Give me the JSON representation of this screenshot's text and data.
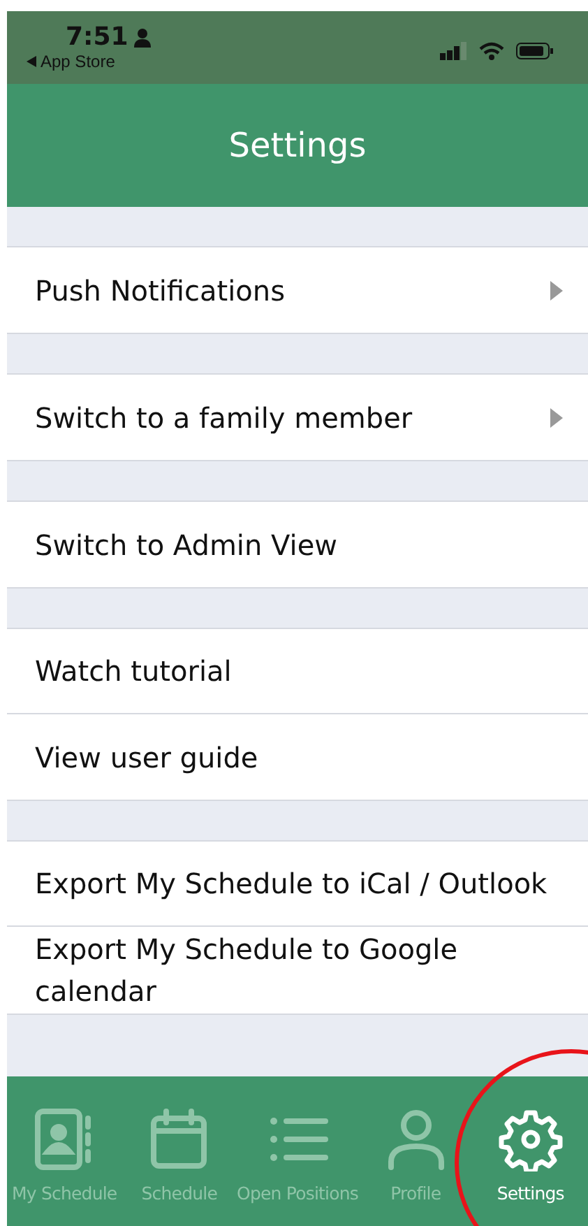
{
  "status_bar": {
    "time": "7:51",
    "back_label": "App Store"
  },
  "header": {
    "title": "Settings"
  },
  "sections": [
    {
      "items": [
        {
          "label": "Push Notifications",
          "kind": "submenu"
        }
      ]
    },
    {
      "items": [
        {
          "label": "Switch to a family member",
          "kind": "submenu"
        }
      ]
    },
    {
      "items": [
        {
          "label": "Switch to Admin View",
          "kind": "action"
        }
      ]
    },
    {
      "items": [
        {
          "label": "Watch tutorial",
          "kind": "action"
        },
        {
          "label": "View user guide",
          "kind": "action"
        }
      ]
    },
    {
      "items": [
        {
          "label": "Export My Schedule to iCal / Outlook",
          "kind": "action"
        },
        {
          "label": "Export My Schedule to Google calendar",
          "kind": "action"
        }
      ]
    }
  ],
  "tab_bar": [
    {
      "label": "My Schedule",
      "kind": "contacts",
      "selected": false
    },
    {
      "label": "Schedule",
      "kind": "calendar",
      "selected": false
    },
    {
      "label": "Open Positions",
      "kind": "list",
      "selected": false
    },
    {
      "label": "Profile",
      "kind": "person",
      "selected": false
    },
    {
      "label": "Settings",
      "kind": "gear",
      "selected": true
    }
  ]
}
